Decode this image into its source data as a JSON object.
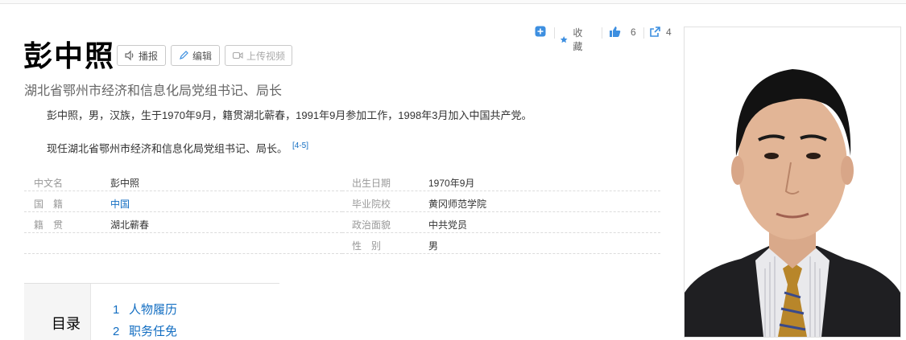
{
  "header": {
    "title": "彭中照",
    "buttons": {
      "broadcast": "播报",
      "edit": "编辑",
      "upload_video": "上传视频"
    },
    "subtitle": "湖北省鄂州市经济和信息化局党组书记、局长"
  },
  "actions": {
    "favorite_label": "收藏",
    "like_count": "6",
    "share_count": "4"
  },
  "summary": {
    "paragraph1": "彭中照，男，汉族，生于1970年9月，籍贯湖北蕲春，1991年9月参加工作，1998年3月加入中国共产党。",
    "paragraph2": "现任湖北省鄂州市经济和信息化局党组书记、局长。",
    "ref": "[4-5]"
  },
  "basic_info": {
    "left": [
      {
        "name": "中文名",
        "value": "彭中照"
      },
      {
        "name": "国　籍",
        "value": "中国"
      },
      {
        "name": "籍　贯",
        "value": "湖北蕲春"
      }
    ],
    "right": [
      {
        "name": "出生日期",
        "value": "1970年9月"
      },
      {
        "name": "毕业院校",
        "value": "黄冈师范学院"
      },
      {
        "name": "政治面貌",
        "value": "中共党员"
      },
      {
        "name": "性　别",
        "value": "男"
      }
    ]
  },
  "toc": {
    "label": "目录",
    "items": [
      {
        "num": "1",
        "text": "人物履历"
      },
      {
        "num": "2",
        "text": "职务任免"
      }
    ]
  },
  "colors": {
    "link": "#136ec2",
    "accent_icon": "#3d8fe0"
  },
  "icons": [
    "plus-square-icon",
    "star-icon",
    "thumbs-up-icon",
    "share-icon",
    "speaker-icon",
    "pencil-icon",
    "video-icon"
  ]
}
